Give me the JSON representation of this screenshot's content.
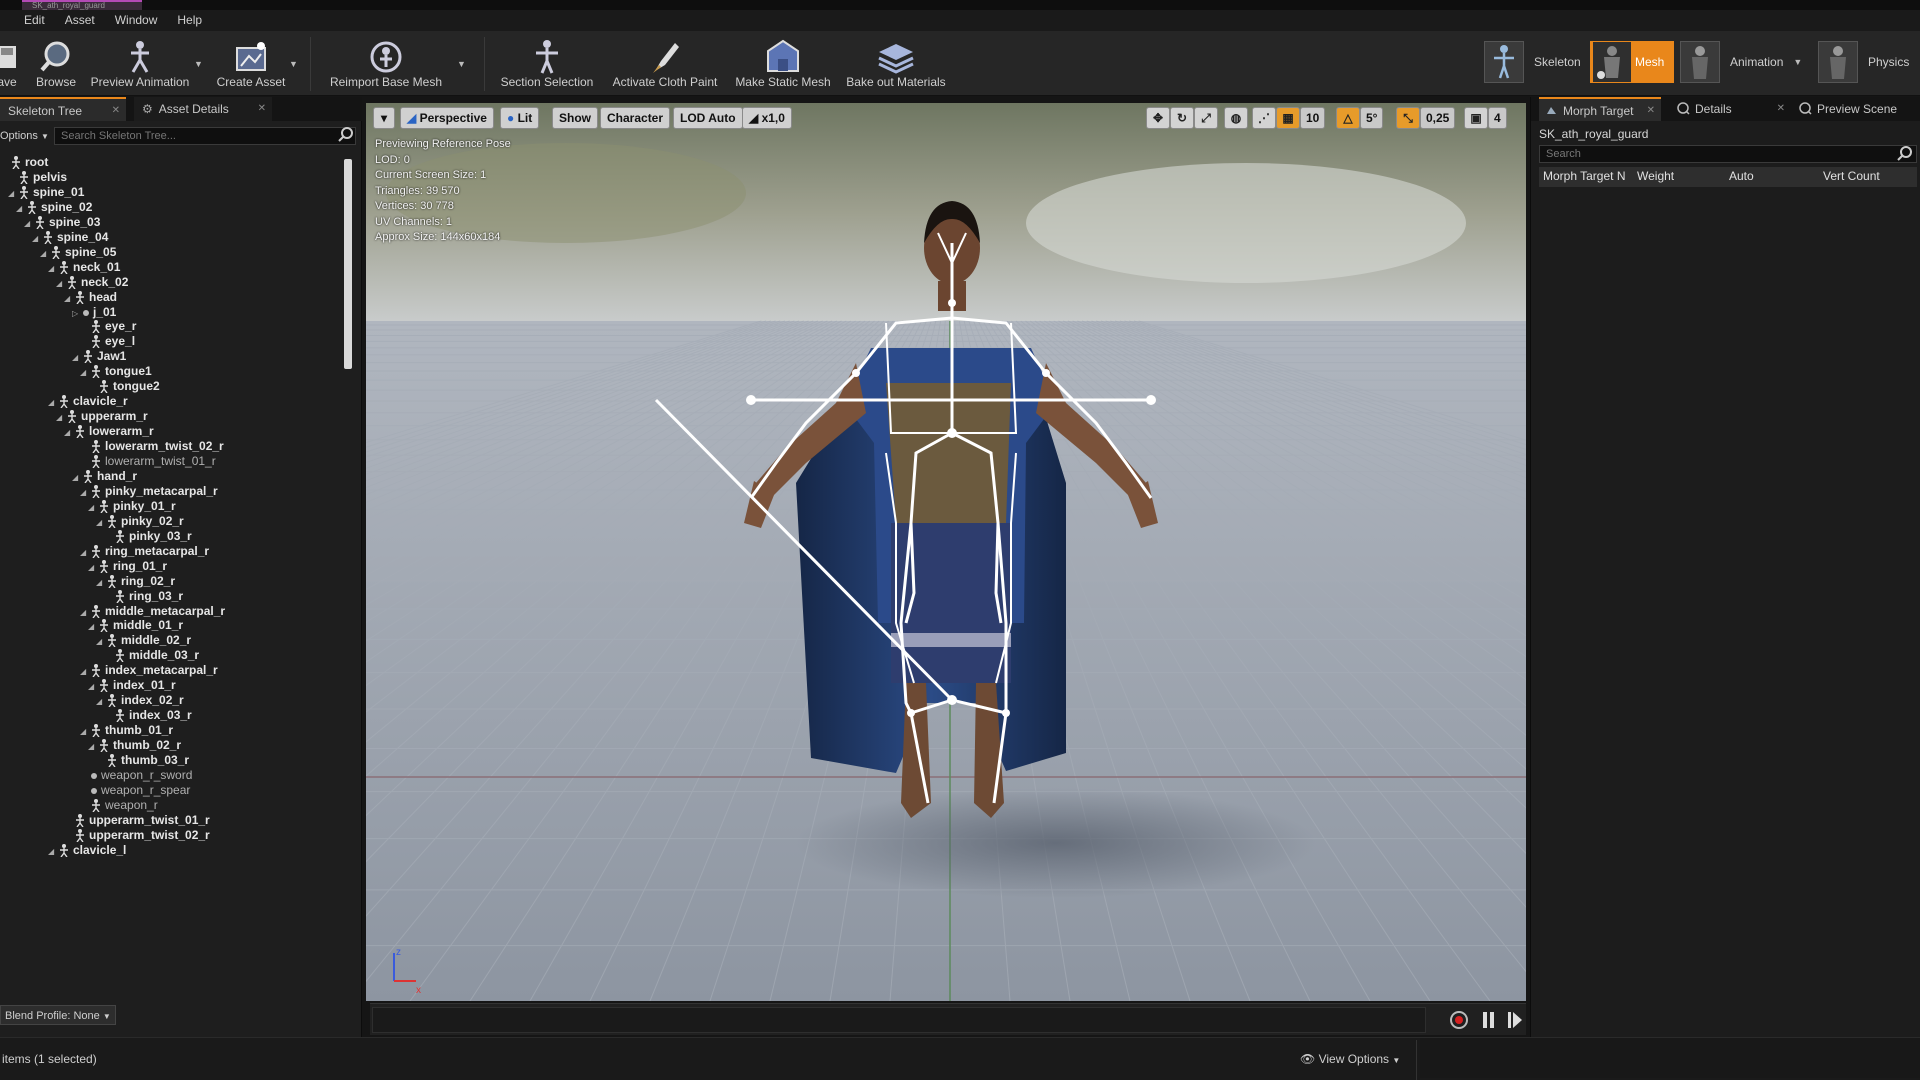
{
  "window": {
    "tab_title": "SK_ath_royal_guard"
  },
  "menu": [
    "Edit",
    "Asset",
    "Window",
    "Help"
  ],
  "toolbar": {
    "save": "ave",
    "browse": "Browse",
    "preview_animation": "Preview Animation",
    "create_asset": "Create Asset",
    "reimport": "Reimport Base Mesh",
    "section_selection": "Section Selection",
    "activate_cloth": "Activate Cloth Paint",
    "make_static_mesh": "Make Static Mesh",
    "bake_materials": "Bake out Materials"
  },
  "modes": {
    "skeleton": "Skeleton",
    "mesh": "Mesh",
    "animation": "Animation",
    "physics": "Physics"
  },
  "left_panel": {
    "tab_skeleton": "Skeleton Tree",
    "tab_asset": "Asset Details",
    "options": "Options",
    "search_placeholder": "Search Skeleton Tree...",
    "blend_profile": "Blend Profile: None"
  },
  "bones": [
    {
      "name": "root",
      "depth": 0,
      "kind": "bone",
      "expander": ""
    },
    {
      "name": "pelvis",
      "depth": 1,
      "kind": "bone",
      "expander": ""
    },
    {
      "name": "spine_01",
      "depth": 1,
      "kind": "bone",
      "expander": "open"
    },
    {
      "name": "spine_02",
      "depth": 2,
      "kind": "bone",
      "expander": "open"
    },
    {
      "name": "spine_03",
      "depth": 3,
      "kind": "bone",
      "expander": "open"
    },
    {
      "name": "spine_04",
      "depth": 4,
      "kind": "bone",
      "expander": "open"
    },
    {
      "name": "spine_05",
      "depth": 5,
      "kind": "bone",
      "expander": "open"
    },
    {
      "name": "neck_01",
      "depth": 6,
      "kind": "bone",
      "expander": "open"
    },
    {
      "name": "neck_02",
      "depth": 7,
      "kind": "bone",
      "expander": "open"
    },
    {
      "name": "head",
      "depth": 8,
      "kind": "bone",
      "expander": "open"
    },
    {
      "name": "j_01",
      "depth": 9,
      "kind": "socket",
      "expander": "closed"
    },
    {
      "name": "eye_r",
      "depth": 10,
      "kind": "bone",
      "expander": ""
    },
    {
      "name": "eye_l",
      "depth": 10,
      "kind": "bone",
      "expander": ""
    },
    {
      "name": "Jaw1",
      "depth": 9,
      "kind": "bone",
      "expander": "open"
    },
    {
      "name": "tongue1",
      "depth": 10,
      "kind": "bone",
      "expander": "open"
    },
    {
      "name": "tongue2",
      "depth": 11,
      "kind": "bone",
      "expander": ""
    },
    {
      "name": "clavicle_r",
      "depth": 6,
      "kind": "bone",
      "expander": "open"
    },
    {
      "name": "upperarm_r",
      "depth": 7,
      "kind": "bone",
      "expander": "open"
    },
    {
      "name": "lowerarm_r",
      "depth": 8,
      "kind": "bone",
      "expander": "open"
    },
    {
      "name": "lowerarm_twist_02_r",
      "depth": 10,
      "kind": "bone",
      "expander": ""
    },
    {
      "name": "lowerarm_twist_01_r",
      "depth": 10,
      "kind": "bone",
      "expander": "",
      "dim": true
    },
    {
      "name": "hand_r",
      "depth": 9,
      "kind": "bone",
      "expander": "open"
    },
    {
      "name": "pinky_metacarpal_r",
      "depth": 10,
      "kind": "bone",
      "expander": "open"
    },
    {
      "name": "pinky_01_r",
      "depth": 11,
      "kind": "bone",
      "expander": "open"
    },
    {
      "name": "pinky_02_r",
      "depth": 12,
      "kind": "bone",
      "expander": "open"
    },
    {
      "name": "pinky_03_r",
      "depth": 13,
      "kind": "bone",
      "expander": ""
    },
    {
      "name": "ring_metacarpal_r",
      "depth": 10,
      "kind": "bone",
      "expander": "open"
    },
    {
      "name": "ring_01_r",
      "depth": 11,
      "kind": "bone",
      "expander": "open"
    },
    {
      "name": "ring_02_r",
      "depth": 12,
      "kind": "bone",
      "expander": "open"
    },
    {
      "name": "ring_03_r",
      "depth": 13,
      "kind": "bone",
      "expander": ""
    },
    {
      "name": "middle_metacarpal_r",
      "depth": 10,
      "kind": "bone",
      "expander": "open"
    },
    {
      "name": "middle_01_r",
      "depth": 11,
      "kind": "bone",
      "expander": "open"
    },
    {
      "name": "middle_02_r",
      "depth": 12,
      "kind": "bone",
      "expander": "open"
    },
    {
      "name": "middle_03_r",
      "depth": 13,
      "kind": "bone",
      "expander": ""
    },
    {
      "name": "index_metacarpal_r",
      "depth": 10,
      "kind": "bone",
      "expander": "open"
    },
    {
      "name": "index_01_r",
      "depth": 11,
      "kind": "bone",
      "expander": "open"
    },
    {
      "name": "index_02_r",
      "depth": 12,
      "kind": "bone",
      "expander": "open"
    },
    {
      "name": "index_03_r",
      "depth": 13,
      "kind": "bone",
      "expander": ""
    },
    {
      "name": "thumb_01_r",
      "depth": 10,
      "kind": "bone",
      "expander": "open"
    },
    {
      "name": "thumb_02_r",
      "depth": 11,
      "kind": "bone",
      "expander": "open"
    },
    {
      "name": "thumb_03_r",
      "depth": 12,
      "kind": "bone",
      "expander": ""
    },
    {
      "name": "weapon_r_sword",
      "depth": 10,
      "kind": "socket",
      "expander": "",
      "dim": true
    },
    {
      "name": "weapon_r_spear",
      "depth": 10,
      "kind": "socket",
      "expander": "",
      "dim": true
    },
    {
      "name": "weapon_r",
      "depth": 10,
      "kind": "bone",
      "expander": "",
      "dim": true
    },
    {
      "name": "upperarm_twist_01_r",
      "depth": 8,
      "kind": "bone",
      "expander": ""
    },
    {
      "name": "upperarm_twist_02_r",
      "depth": 8,
      "kind": "bone",
      "expander": ""
    },
    {
      "name": "clavicle_l",
      "depth": 6,
      "kind": "bone",
      "expander": "open"
    }
  ],
  "viewport": {
    "menu": "▾",
    "perspective": "Perspective",
    "lit": "Lit",
    "show": "Show",
    "character": "Character",
    "lod": "LOD Auto",
    "speed": "x1,0",
    "grid_snap": "10",
    "rot_snap": "5°",
    "scale_snap": "0,25",
    "cam_speed": "4",
    "stats": [
      "Previewing Reference Pose",
      "LOD: 0",
      "Current Screen Size: 1",
      "Triangles: 39 570",
      "Vertices: 30 778",
      "UV Channels: 1",
      "Approx Size: 144x60x184"
    ]
  },
  "right_panel": {
    "tab_morph": "Morph Target",
    "tab_details": "Details",
    "tab_preview": "Preview Scene",
    "asset_name": "SK_ath_royal_guard",
    "search_placeholder": "Search",
    "col_name": "Morph Target N",
    "col_weight": "Weight",
    "col_auto": "Auto",
    "col_vert": "Vert Count"
  },
  "statusbar": {
    "items": "items (1 selected)",
    "view_options": "View Options"
  },
  "colors": {
    "accent": "#e9871b",
    "panel": "#1e1e1e",
    "viewport_floor": "#9aa2ad"
  }
}
